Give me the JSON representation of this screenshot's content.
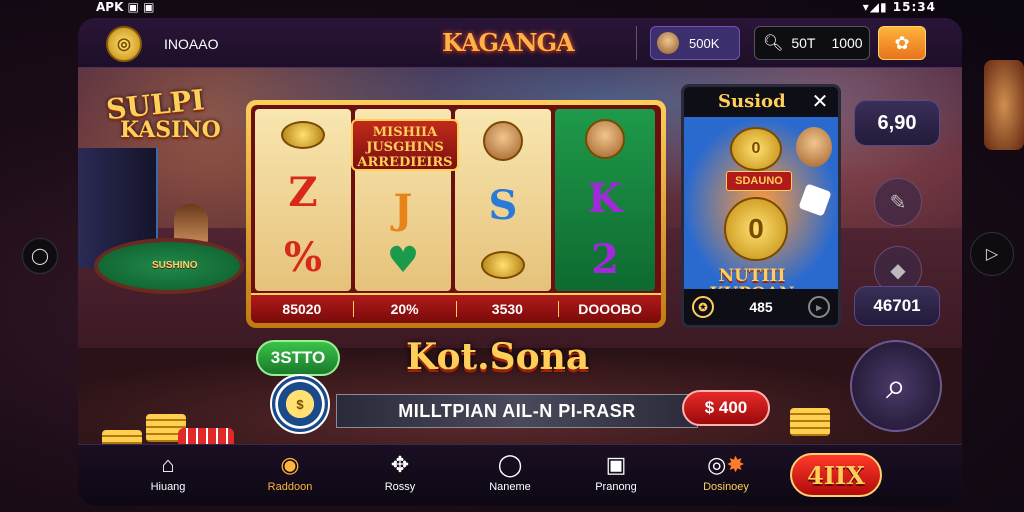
{
  "status_bar": {
    "left": "APK ▣ ▣",
    "right": "▾◢▮ 15:34"
  },
  "header": {
    "username": "INOAAO",
    "brand_title": "KAGANGA",
    "profile_amount": "500K",
    "search_left": "50T",
    "search_right": "1000"
  },
  "left_logo": {
    "line1": "SULPI",
    "line2": "KASINO"
  },
  "table_label": "SUSHINO",
  "slot": {
    "banner": "MISHIIA JUSGHINS ARREDIEIRS",
    "footer": [
      "85020",
      "20%",
      "3530",
      "DOOOBO"
    ],
    "symbols": [
      [
        "coin",
        "Z",
        "%"
      ],
      [
        "J",
        "heart"
      ],
      [
        "face",
        "S",
        "coins"
      ],
      [
        "face",
        "K",
        "2"
      ]
    ]
  },
  "popup": {
    "title": "Susiod",
    "badge": "SDAUNO",
    "promo": "NUTIII KUPOAN",
    "footer_value": "485"
  },
  "right_panel": {
    "top_value": "6,90",
    "mid_value": "46701"
  },
  "balance_label": "3STTO",
  "game_title": "Kot.Sona",
  "banner_text": "MILLTPIAN AIL-N PI-RASR",
  "bet_label": "$ 400",
  "bottom_nav": [
    {
      "label": "Hiuang",
      "icon": "home-icon"
    },
    {
      "label": "Raddoon",
      "icon": "coins-icon"
    },
    {
      "label": "Rossy",
      "icon": "puzzle-icon"
    },
    {
      "label": "Naneme",
      "icon": "ring-icon"
    },
    {
      "label": "Pranong",
      "icon": "grid-icon"
    },
    {
      "label": "Dosinoey",
      "icon": "target-icon"
    }
  ],
  "action_button": "4IIX",
  "colors": {
    "gold": "#ffcf5a",
    "red": "#b01a1a",
    "green": "#1f9a4a",
    "purple": "#3d2e6e"
  }
}
